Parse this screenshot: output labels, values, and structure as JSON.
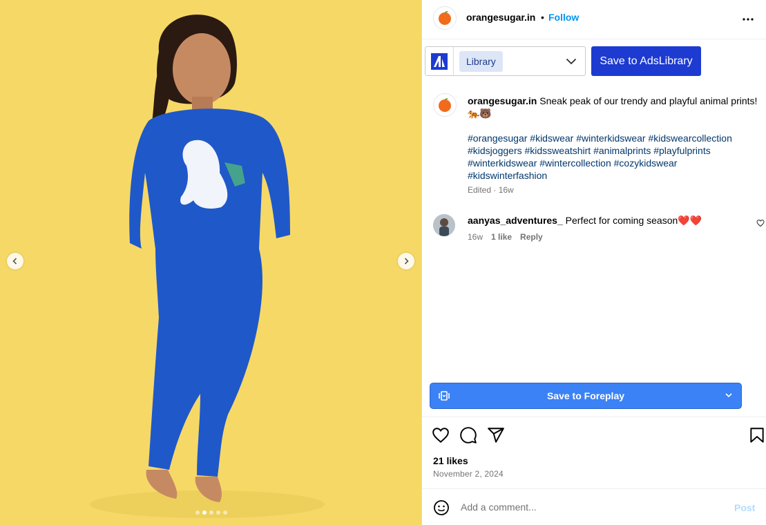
{
  "post": {
    "username": "orangesugar.in",
    "separator": "•",
    "follow_label": "Follow",
    "more_icon": "more-horizontal-icon"
  },
  "media": {
    "carousel_total": 5,
    "carousel_active": 1,
    "prev_icon": "chevron-left-icon",
    "next_icon": "chevron-right-icon",
    "background_color": "#f6d867",
    "outfit_color": "#1f58c9"
  },
  "toolbar": {
    "library_chip": "Library",
    "save_ads_label": "Save to AdsLibrary",
    "accent": "#1d3bd1"
  },
  "caption": {
    "username": "orangesugar.in",
    "text": "Sneak peak of our trendy and playful animal prints!🐅🐻",
    "hashtags": "#orangesugar #kidswear #winterkidswear #kidswearcollection #kidsjoggers #kidssweatshirt #animalprints #playfulprints #winterkidswear #wintercollection #cozykidswear #kidswinterfashion",
    "edited": "Edited · 16w"
  },
  "comment": {
    "username": "aanyas_adventures_",
    "text": "Perfect for coming season❤️❤️",
    "age": "16w",
    "likes": "1 like",
    "reply": "Reply"
  },
  "foreplay": {
    "label": "Save to Foreplay",
    "color": "#3b82f6"
  },
  "actions": {
    "like_icon": "heart-icon",
    "comment_icon": "comment-icon",
    "share_icon": "send-icon",
    "save_icon": "bookmark-icon"
  },
  "stats": {
    "likes": "21 likes",
    "date": "November 2, 2024"
  },
  "compose": {
    "placeholder": "Add a comment...",
    "post_label": "Post"
  }
}
